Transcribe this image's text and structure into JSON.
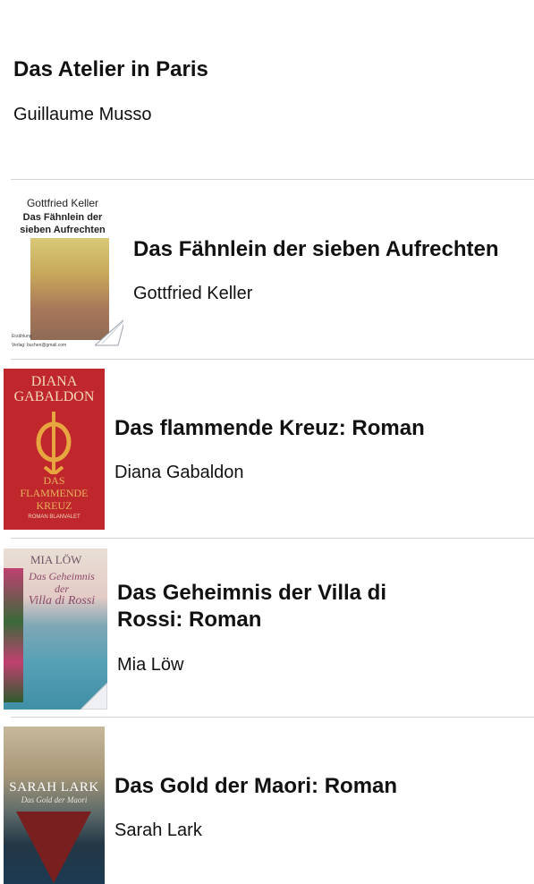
{
  "books": [
    {
      "title": "Das Atelier in Paris",
      "author": "Guillaume Musso"
    },
    {
      "title": "Das Fähnlein der sieben Aufrechten",
      "author": "Gottfried Keller",
      "cover": {
        "author": "Gottfried Keller",
        "title": "Das Fähnlein der sieben Aufrechten",
        "footer_1": "Erzählung",
        "footer_2": "Verlag: buchen@gmail.com"
      }
    },
    {
      "title": "Das flammende Kreuz: Roman",
      "author": "Diana Gabaldon",
      "cover": {
        "author_line_1": "DIANA",
        "author_line_2": "GABALDON",
        "title_line_1": "DAS",
        "title_line_2": "FLAMMENDE",
        "title_line_3": "KREUZ",
        "footer": "ROMAN     BLANVALET"
      }
    },
    {
      "title": "Das Geheimnis der Villa di Rossi: Roman",
      "author": "Mia Löw",
      "cover": {
        "author": "MIA LÖW",
        "title_line_1": "Das Geheimnis",
        "title_line_2": "der",
        "title_line_3": "Villa di Rossi"
      }
    },
    {
      "title": "Das Gold der Maori: Roman",
      "author": "Sarah Lark",
      "cover": {
        "author": "SARAH LARK",
        "title": "Das Gold der Maori"
      }
    }
  ],
  "colors": {
    "divider": "#d4d4d6",
    "gabaldon_cover": "#c0272d"
  }
}
